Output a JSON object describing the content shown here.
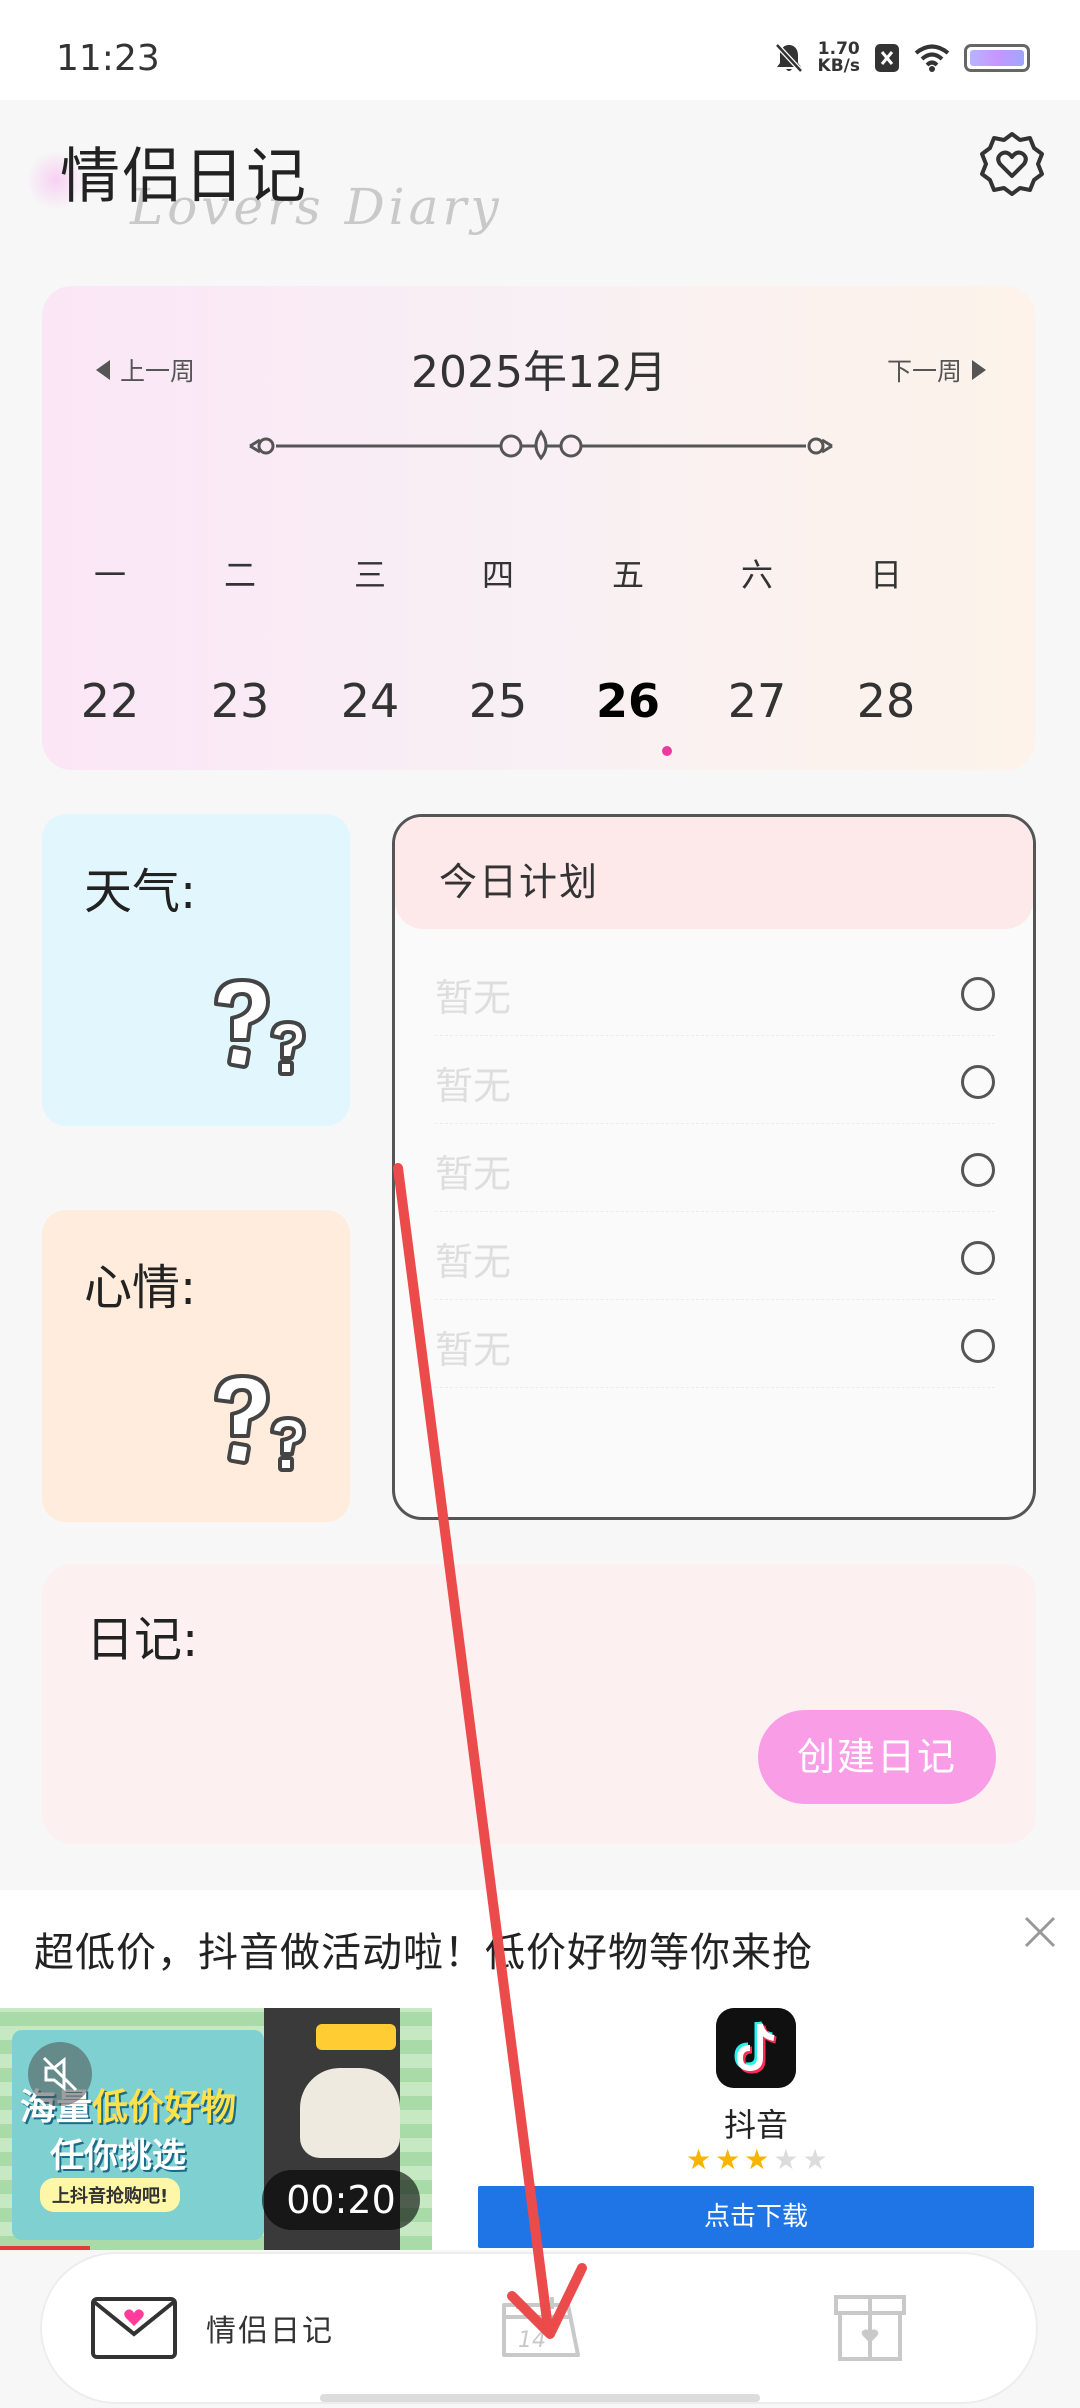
{
  "status_bar": {
    "time": "11:23",
    "net_speed_value": "1.70",
    "net_speed_unit": "KB/s"
  },
  "header": {
    "title": "情侣日记",
    "subtitle": "Lovers Diary",
    "settings_icon": "heart-gear-icon"
  },
  "calendar": {
    "prev_label": "上一周",
    "next_label": "下一周",
    "month_title": "2025年12月",
    "weekdays": [
      "一",
      "二",
      "三",
      "四",
      "五",
      "六",
      "日"
    ],
    "days": [
      "22",
      "23",
      "24",
      "25",
      "26",
      "27",
      "28"
    ],
    "today": "26",
    "accent_color": "#ee3aa0"
  },
  "weather": {
    "label": "天气:",
    "icon": "question-mark-icon"
  },
  "mood": {
    "label": "心情:",
    "icon": "question-mark-icon"
  },
  "plan": {
    "title": "今日计划",
    "items": [
      {
        "text": "暂无"
      },
      {
        "text": "暂无"
      },
      {
        "text": "暂无"
      },
      {
        "text": "暂无"
      },
      {
        "text": "暂无"
      }
    ]
  },
  "diary": {
    "label": "日记:",
    "create_button": "创建日记",
    "button_color": "#f89de6"
  },
  "ad": {
    "headline": "超低价，抖音做活动啦！低价好物等你来抢",
    "promo_line1_a": "海量",
    "promo_line1_b": "低价好物",
    "promo_line2": "任你挑选",
    "promo_line3": "上抖音抢购吧!",
    "timer": "00:20",
    "app_name": "抖音",
    "rating": 3,
    "rating_max": 5,
    "download_button": "点击下载",
    "button_color": "#1f74e6"
  },
  "bottom_nav": {
    "items": [
      {
        "label": "情侣日记",
        "icon": "love-letter-icon"
      },
      {
        "label": "",
        "icon": "calendar-14-icon"
      },
      {
        "label": "",
        "icon": "gift-box-icon"
      }
    ]
  }
}
